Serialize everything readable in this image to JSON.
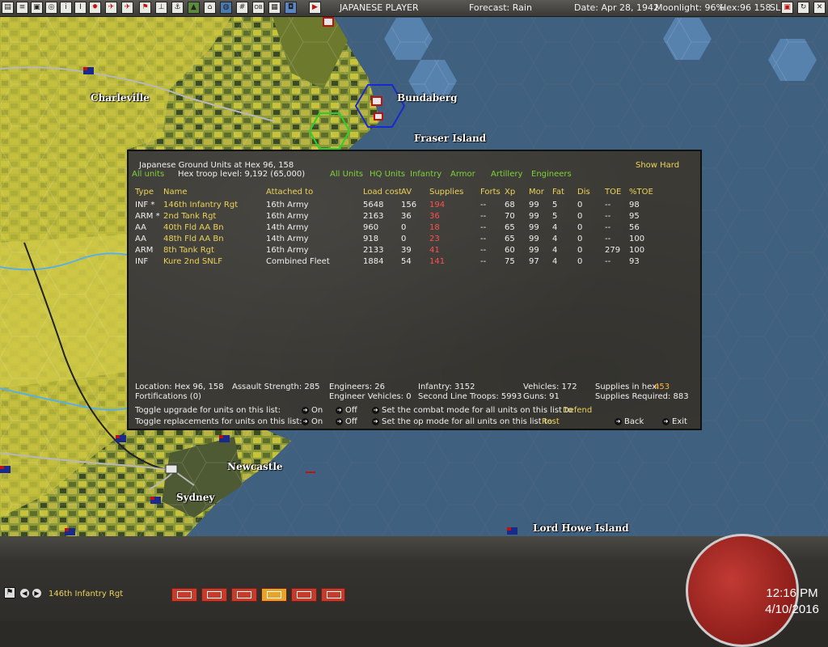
{
  "topbar": {
    "player": "JAPANESE PLAYER",
    "forecast": "Forecast: Rain",
    "date": "Date: Apr 28, 1942",
    "moonlight": "Moonlight: 96%",
    "hex": "Hex:96 158",
    "sl": "SL: 0"
  },
  "map": {
    "places": [
      "Charleville",
      "Bundaberg",
      "Fraser Island",
      "Newcastle",
      "Sydney",
      "Lord Howe Island"
    ]
  },
  "panel": {
    "title": "Japanese Ground Units at Hex 96, 158",
    "show_hard": "Show Hard",
    "all_units_left": "All units",
    "troop_level": "Hex troop level: 9,192  (65,000)",
    "filters": [
      "All Units",
      "HQ Units",
      "Infantry",
      "Armor",
      "Artillery",
      "Engineers"
    ],
    "headers": [
      "Type",
      "Name",
      "Attached to",
      "Load cost",
      "AV",
      "Supplies",
      "Forts",
      "Xp",
      "Mor",
      "Fat",
      "Dis",
      "TOE",
      "%TOE"
    ],
    "rows": [
      {
        "type": "INF *",
        "name": "146th Infantry Rgt",
        "attached": "16th Army",
        "load": "5648",
        "av": "156",
        "supplies": "194",
        "forts": "--",
        "xp": "68",
        "mor": "99",
        "fat": "5",
        "dis": "0",
        "toe": "--",
        "ptoe": "98"
      },
      {
        "type": "ARM *",
        "name": "2nd Tank Rgt",
        "attached": "16th Army",
        "load": "2163",
        "av": "36",
        "supplies": "36",
        "forts": "--",
        "xp": "70",
        "mor": "99",
        "fat": "5",
        "dis": "0",
        "toe": "--",
        "ptoe": "95"
      },
      {
        "type": "AA",
        "name": "40th Fld AA Bn",
        "attached": "14th Army",
        "load": "960",
        "av": "0",
        "supplies": "18",
        "forts": "--",
        "xp": "65",
        "mor": "99",
        "fat": "4",
        "dis": "0",
        "toe": "--",
        "ptoe": "56"
      },
      {
        "type": "AA",
        "name": "48th Fld AA Bn",
        "attached": "14th Army",
        "load": "918",
        "av": "0",
        "supplies": "23",
        "forts": "--",
        "xp": "65",
        "mor": "99",
        "fat": "4",
        "dis": "0",
        "toe": "--",
        "ptoe": "100"
      },
      {
        "type": "ARM",
        "name": "8th Tank Rgt",
        "attached": "16th Army",
        "load": "2133",
        "av": "39",
        "supplies": "41",
        "forts": "--",
        "xp": "60",
        "mor": "99",
        "fat": "4",
        "dis": "0",
        "toe": "279",
        "ptoe": "100"
      },
      {
        "type": "INF",
        "name": "Kure 2nd SNLF",
        "attached": "Combined Fleet",
        "load": "1884",
        "av": "54",
        "supplies": "141",
        "forts": "--",
        "xp": "75",
        "mor": "97",
        "fat": "4",
        "dis": "0",
        "toe": "--",
        "ptoe": "93"
      }
    ],
    "summary": {
      "location": "Location: Hex 96, 158",
      "fortifications": "Fortifications (0)",
      "assault": "Assault Strength: 285",
      "engineers": "Engineers: 26",
      "engineer_vehicles": "Engineer Vehicles: 0",
      "infantry": "Infantry: 3152",
      "second_line": "Second Line Troops: 5993",
      "vehicles": "Vehicles: 172",
      "guns": "Guns: 91",
      "supplies_in_hex_label": "Supplies in hex:",
      "supplies_in_hex": "453",
      "supplies_required": "Supplies Required: 883"
    },
    "toggles": {
      "upgrade_label": "Toggle upgrade for units on this list:",
      "replacements_label": "Toggle replacements for units on this list:",
      "on": "On",
      "off": "Off",
      "combat_label": "Set the combat mode for all units on this list to",
      "combat_value": "Defend",
      "op_label": "Set the op mode for all units on this list to",
      "op_value": "Rest",
      "back": "Back",
      "exit": "Exit"
    }
  },
  "bottom": {
    "selected_unit": "146th Infantry Rgt",
    "time": "12:16 PM",
    "date": "4/10/2016"
  }
}
